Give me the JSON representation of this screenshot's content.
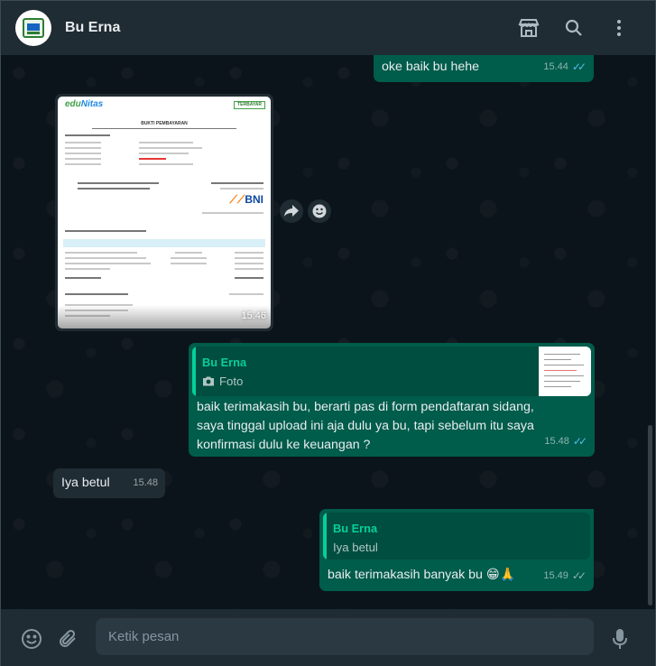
{
  "header": {
    "contact_name": "Bu Erna",
    "icons": [
      "store-icon",
      "search-icon",
      "menu-icon"
    ]
  },
  "messages": [
    {
      "direction": "out",
      "text": "oke baik bu hehe",
      "time": "15.44",
      "status": "read"
    },
    {
      "direction": "in",
      "type": "image",
      "time": "15.46",
      "receipt": {
        "brand_a": "edu",
        "brand_b": "Nitas",
        "badge": "TERBAYAR",
        "title": "BUKTI PEMBAYARAN",
        "bank": "BNI"
      }
    },
    {
      "direction": "out",
      "quote_name": "Bu Erna",
      "quote_text": "Foto",
      "text": "baik terimakasih bu, berarti pas di form pendaftaran sidang, saya tinggal upload ini aja dulu ya bu, tapi sebelum itu saya konfirmasi dulu ke keuangan ?",
      "time": "15.48",
      "status": "read"
    },
    {
      "direction": "in",
      "text": "Iya betul",
      "time": "15.48"
    },
    {
      "direction": "out",
      "quote_name": "Bu Erna",
      "quote_text": "Iya betul",
      "text": "baik terimakasih banyak bu",
      "emoji": "😁🙏",
      "time": "15.49",
      "status": "delivered"
    }
  ],
  "composer": {
    "placeholder": "Ketik pesan"
  },
  "colors": {
    "outgoing_bubble": "#005c4b",
    "incoming_bubble": "#202c33",
    "read_tick": "#53bdeb",
    "quote_accent": "#06cf9c"
  }
}
